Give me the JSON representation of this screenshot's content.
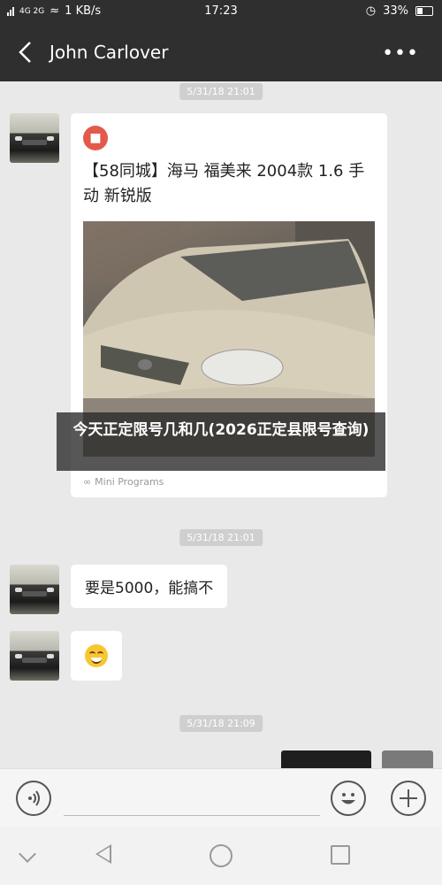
{
  "status_bar": {
    "network_labels": [
      "2G",
      "4G 2G"
    ],
    "speed": "1 KB/s",
    "time": "17:23",
    "battery": "33%"
  },
  "header": {
    "title": "John Carlover",
    "back_icon": "chevron-left-icon",
    "more_icon": "more-dots-icon"
  },
  "messages": [
    {
      "timestamp": "5/31/18 21:01"
    },
    {
      "type": "mini_program_card",
      "title": "【58同城】海马 福美来 2004款 1.6 手动 新锐版",
      "footer": "Mini Programs",
      "app_icon": "58-app-icon"
    },
    {
      "timestamp": "5/31/18 21:01"
    },
    {
      "type": "text",
      "text": "要是5000，能搞不"
    },
    {
      "type": "emoji",
      "emoji": "grin-emoji"
    },
    {
      "timestamp": "5/31/18 21:09"
    }
  ],
  "overlay_caption": "今天正定限号几和几(2026正定县限号查询)",
  "input_bar": {
    "voice_icon": "voice-icon",
    "emoji_icon": "emoji-icon",
    "plus_icon": "plus-icon"
  },
  "colors": {
    "header_bg": "#2f2f2f",
    "chat_bg": "#e9e9e9",
    "timestamp_bg": "#cfcfcf"
  }
}
